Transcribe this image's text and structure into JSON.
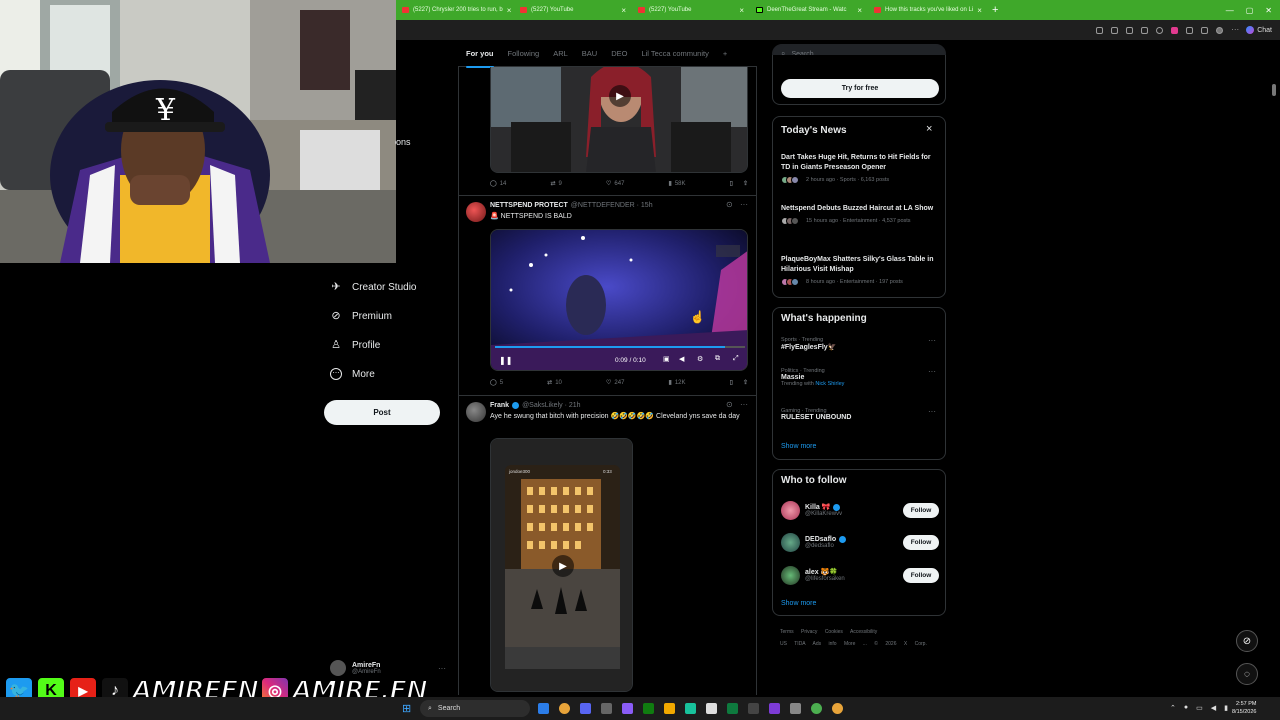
{
  "browser": {
    "tabs": [
      {
        "label": "(5227) Chrysler 200 tries to run, b",
        "color": "#e33"
      },
      {
        "label": "(5227) YouTube",
        "color": "#e33"
      },
      {
        "label": "(5227) YouTube",
        "color": "#e33"
      },
      {
        "label": "DeenTheGreat Stream - Watc",
        "color": "#53fc18"
      },
      {
        "label": "How this tracks you've liked on Li",
        "color": "#e33"
      }
    ],
    "new_tab": "+",
    "chat_label": "Chat"
  },
  "webcam": {
    "overlay_text": "ons"
  },
  "nav": {
    "items": [
      {
        "label": "Creator Studio",
        "icon": "creator-studio-icon",
        "glyph": "✈"
      },
      {
        "label": "Premium",
        "icon": "premium-icon",
        "glyph": "⊘"
      },
      {
        "label": "Profile",
        "icon": "profile-icon",
        "glyph": "♙"
      },
      {
        "label": "More",
        "icon": "more-icon",
        "glyph": "⋯"
      }
    ],
    "post_label": "Post",
    "account_name": "AmireFn",
    "account_handle": "@AmireFn",
    "account_more": "···"
  },
  "feed": {
    "tabs": [
      {
        "label": "For you",
        "active": true
      },
      {
        "label": "Following",
        "active": false
      },
      {
        "label": "ARL",
        "active": false
      },
      {
        "label": "BAU",
        "active": false
      },
      {
        "label": "DEO",
        "active": false
      },
      {
        "label": "Lil Tecca community",
        "active": false
      },
      {
        "label": "+",
        "active": false
      }
    ],
    "tweet1_actions": {
      "replies": "14",
      "reposts": "9",
      "likes": "647",
      "views": "58K"
    },
    "tweet2": {
      "name": "NETTSPEND PROTECT",
      "handle": "@NETTDEFENDER · 15h",
      "text": "🚨 NETTSPEND IS BALD",
      "video_time": "0:09 / 0:10",
      "actions": {
        "replies": "5",
        "reposts": "10",
        "likes": "247",
        "views": "12K"
      }
    },
    "tweet3": {
      "name": "Frank",
      "handle": "@SaksLikely · 21h",
      "text": "Aye he swung that bitch with precision 🤣🤣🤣🤣🤣 Cleveland yns save da day",
      "video_handle": "jondoe300",
      "video_time": "0:33"
    }
  },
  "sidebar": {
    "search_placeholder": "Search",
    "try_label": "Try for free",
    "news": {
      "title": "Today's News",
      "close": "×",
      "items": [
        {
          "title": "Dart Takes Huge Hit, Returns to Hit Fields for TD in Giants Preseason Opener",
          "meta": "2 hours ago · Sports · 6,163 posts"
        },
        {
          "title": "Nettspend Debuts Buzzed Haircut at LA Show",
          "meta": "15 hours ago · Entertainment · 4,537 posts"
        },
        {
          "title": "PlaqueBoyMax Shatters Silky's Glass Table in Hilarious Visit Mishap",
          "meta": "8 hours ago · Entertainment · 197 posts"
        }
      ]
    },
    "happening": {
      "title": "What's happening",
      "items": [
        {
          "meta": "Sports · Trending",
          "name": "#FlyEaglesFly🦅",
          "extra_label": "",
          "extra_link": ""
        },
        {
          "meta": "Politics · Trending",
          "name": "Massie",
          "extra_label": "Trending with",
          "extra_link": "Nick Shirley"
        },
        {
          "meta": "Gaming · Trending",
          "name": "RULESET UNBOUND",
          "extra_label": "",
          "extra_link": ""
        }
      ],
      "show_more": "Show more"
    },
    "who_to_follow": {
      "title": "Who to follow",
      "items": [
        {
          "name": "Killa 🎀",
          "handle": "@KillaKrewvv",
          "button": "Follow"
        },
        {
          "name": "DEDsaflo",
          "handle": "@dedsaflo",
          "button": "Follow"
        },
        {
          "name": "alex 🐯🍀",
          "handle": "@lifesforsaken",
          "button": "Follow"
        }
      ],
      "show_more": "Show more"
    },
    "footer": {
      "links": [
        "Terms",
        "Privacy",
        "Cookies",
        "Accessibility"
      ],
      "links2": [
        "US TIDA",
        "Ads info",
        "More ...",
        "© 2026 X Corp."
      ]
    }
  },
  "overlay": {
    "handle_x": "AMIREFN",
    "handle_ig": "AMIRE.FN"
  },
  "taskbar": {
    "search_label": "Search",
    "time": "2:57 PM",
    "date": "8/15/2026"
  }
}
